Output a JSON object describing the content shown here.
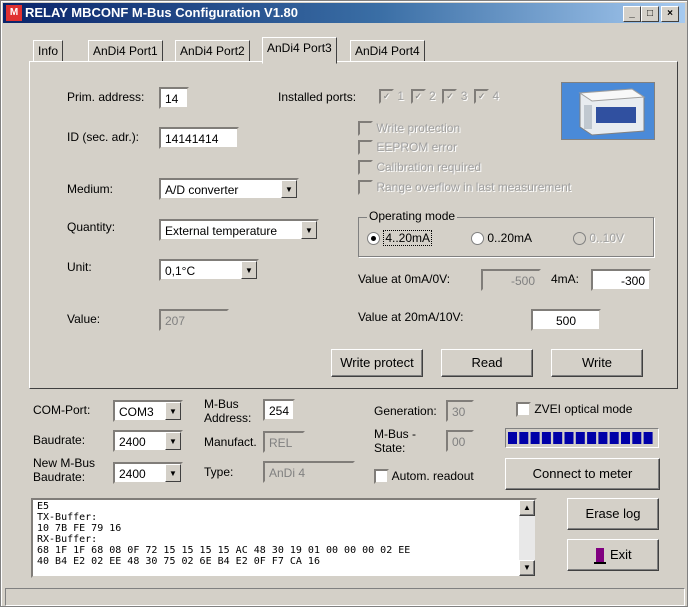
{
  "window": {
    "title": "RELAY MBCONF M-Bus Configuration  V1.80"
  },
  "tabs": [
    {
      "label": "Info"
    },
    {
      "label": "AnDi4 Port1"
    },
    {
      "label": "AnDi4 Port2"
    },
    {
      "label": "AnDi4 Port3"
    },
    {
      "label": "AnDi4 Port4"
    }
  ],
  "active_tab": "AnDi4 Port3",
  "port": {
    "prim_address_label": "Prim. address:",
    "prim_address_value": "14",
    "id_label": "ID (sec. adr.):",
    "id_value": "14141414",
    "medium_label": "Medium:",
    "medium_value": "A/D converter",
    "quantity_label": "Quantity:",
    "quantity_value": "External temperature",
    "unit_label": "Unit:",
    "unit_value": "0,1°C",
    "value_label": "Value:",
    "value_value": "207",
    "installed_ports_label": "Installed ports:",
    "installed_ports": [
      "1",
      "2",
      "3",
      "4"
    ],
    "flags": [
      "Write protection",
      "EEPROM error",
      "Calibration required",
      "Range overflow in last measurement"
    ],
    "operating_mode_label": "Operating mode",
    "modes": [
      "4..20mA",
      "0..20mA",
      "0..10V"
    ],
    "selected_mode": "4..20mA",
    "val0_label": "Value at 0mA/0V:",
    "val0_value": "-500",
    "val4_label": "4mA:",
    "val4_value": "-300",
    "val20_label": "Value at 20mA/10V:",
    "val20_value": "500",
    "write_protect_label": "Write protect",
    "read_label": "Read",
    "write_label": "Write"
  },
  "bottom": {
    "com_port_label": "COM-Port:",
    "com_port_value": "COM3",
    "baudrate_label": "Baudrate:",
    "baudrate_value": "2400",
    "new_baudrate_label_1": "New M-Bus",
    "new_baudrate_label_2": "Baudrate:",
    "new_baudrate_value": "2400",
    "mbus_address_label_1": "M-Bus",
    "mbus_address_label_2": "Address:",
    "mbus_address_value": "254",
    "manufact_label": "Manufact.",
    "manufact_value": "REL",
    "type_label": "Type:",
    "type_value": "AnDi 4",
    "generation_label": "Generation:",
    "generation_value": "30",
    "mbus_state_label_1": "M-Bus -",
    "mbus_state_label_2": "State:",
    "mbus_state_value": "00",
    "zvei_label": "ZVEI optical mode",
    "autom_readout_label": "Autom. readout",
    "connect_label": "Connect to meter",
    "erase_log_label": "Erase log",
    "exit_label": "Exit"
  },
  "log": {
    "lines": [
      "E5",
      "TX-Buffer:",
      "10 7B FE 79 16",
      "RX-Buffer:",
      "68 1F 1F 68 08 0F 72 15 15 15 15 AC 48 30 19 01 00 00 00 02 EE",
      "40 B4 E2 02 EE 48 30 75 02 6E B4 E2 0F F7 CA 16"
    ]
  },
  "colors": {
    "title_start": "#0a246a",
    "title_end": "#a6caf0",
    "progress": "#0000a8",
    "face": "#d4d0c8"
  }
}
